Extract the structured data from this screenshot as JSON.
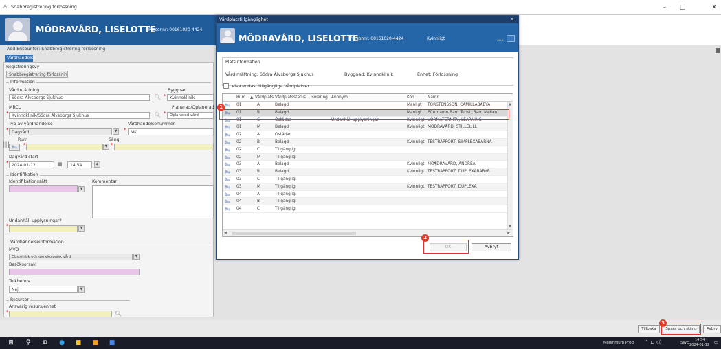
{
  "window": {
    "title": "Snabbregistrering förlossning",
    "minimize": "–",
    "maximize": "□",
    "close": "✕"
  },
  "patient": {
    "name": "MÖDRAVÅRD, LISELOTTE",
    "personnr_label": "Personnr:",
    "personnr": "00161020-4424",
    "gender": "Kvinnligt"
  },
  "encounter": {
    "title": "Add Encounter: Snabbregistrering förlossning",
    "tab": "Vårdhändelse"
  },
  "form": {
    "registreringsvy_label": "Registreringsvy",
    "registreringsvy_value": "Snabbregistrering förlossning",
    "information_label": "Information",
    "vardinrattning_label": "Vårdinrättning",
    "vardinrattning_value": "Södra Älvsborgs Sjukhus",
    "byggnad_label": "Byggnad",
    "byggnad_value": "Kvinnoklinik",
    "mrcu_label": "MRCU",
    "mrcu_value": "Kvinnoklinik/Södra Älvsborgs Sjukhus",
    "planerad_label": "Planerad/Oplanerad",
    "planerad_value": "Oplanerad vård",
    "typ_label": "Typ av vårdhändelse",
    "typ_value": "Dagvård",
    "vhnr_label": "Vårdhändelsenummer",
    "vhnr_value": "MK",
    "rum_label": "Rum",
    "sang_label": "Säng",
    "dagvard_start_label": "Dagvård start",
    "date_value": "2024-01-12",
    "time_value": "14:54",
    "identifikation_label": "Identifikation",
    "identifikationssatt_label": "Identifikationssätt",
    "kommentar_label": "Kommentar",
    "undanhall_label": "Undanhåll upplysningar?",
    "vhinfo_label": "Vårdhändelseinformation",
    "mvo_label": "MVO",
    "mvo_value": "Obstetrisk och gynekologisk vård",
    "besoksorsak_label": "Besöksorsak",
    "tolkbehov_label": "Tolkbehov",
    "tolkbehov_value": "Nej",
    "resurser_label": "Resurser",
    "ansvarig_label": "Ansvarig resurs/enhet"
  },
  "modal": {
    "title": "Vårdplatstillgänglighet",
    "close": "✕",
    "more": "...",
    "platsinfo_label": "Platsinformation",
    "vardinrattning": "Vårdinrättning:  Södra Älvsborgs Sjukhus",
    "byggnad": "Byggnad:  Kvinnoklinik",
    "enhet": "Enhet:  Förlossning",
    "checkbox_label": "Visa endast tillgängliga vårdplatser",
    "columns": [
      "Rum",
      "Vårdplats",
      "Vårdplatsstatus",
      "Isolering",
      "Anonym",
      "Kön",
      "Namn"
    ],
    "rows": [
      {
        "rum": "01",
        "plats": "A",
        "status": "Belagd",
        "anonym": "",
        "kon": "Manligt",
        "namn": "TORSTENSSON, CAMILLABABYA"
      },
      {
        "rum": "01",
        "plats": "B",
        "status": "Belagd",
        "anonym": "",
        "kon": "Manligt",
        "namn": "Efternamn Barn Turist, Barn Mellan"
      },
      {
        "rum": "01",
        "plats": "C",
        "status": "Ostädad",
        "anonym": "Undanhåll upplysningar",
        "kon": "Kvinnligt",
        "namn": "VÖRMATERNITY, LEARNING"
      },
      {
        "rum": "01",
        "plats": "M",
        "status": "Belagd",
        "anonym": "",
        "kon": "Kvinnligt",
        "namn": "MÖDRAVÅRD, STILLELILL"
      },
      {
        "rum": "02",
        "plats": "A",
        "status": "Ostädad",
        "anonym": "",
        "kon": "",
        "namn": ""
      },
      {
        "rum": "02",
        "plats": "B",
        "status": "Belagd",
        "anonym": "",
        "kon": "Kvinnligt",
        "namn": "TESTRAPPORT, SIMPLEXABARNA"
      },
      {
        "rum": "02",
        "plats": "C",
        "status": "Tillgänglig",
        "anonym": "",
        "kon": "",
        "namn": ""
      },
      {
        "rum": "02",
        "plats": "M",
        "status": "Tillgänglig",
        "anonym": "",
        "kon": "",
        "namn": ""
      },
      {
        "rum": "03",
        "plats": "A",
        "status": "Belagd",
        "anonym": "",
        "kon": "Kvinnligt",
        "namn": "MÖ¶DRAVÅRD, ANDREA"
      },
      {
        "rum": "03",
        "plats": "B",
        "status": "Belagd",
        "anonym": "",
        "kon": "Kvinnligt",
        "namn": "TESTRAPPORT, DUPLEXABABYB"
      },
      {
        "rum": "03",
        "plats": "C",
        "status": "Tillgänglig",
        "anonym": "",
        "kon": "",
        "namn": ""
      },
      {
        "rum": "03",
        "plats": "M",
        "status": "Tillgänglig",
        "anonym": "",
        "kon": "Kvinnligt",
        "namn": "TESTRAPPORT, DUPLEXA"
      },
      {
        "rum": "04",
        "plats": "A",
        "status": "Tillgänglig",
        "anonym": "",
        "kon": "",
        "namn": ""
      },
      {
        "rum": "04",
        "plats": "B",
        "status": "Tillgänglig",
        "anonym": "",
        "kon": "",
        "namn": ""
      },
      {
        "rum": "04",
        "plats": "C",
        "status": "Tillgänglig",
        "anonym": "",
        "kon": "",
        "namn": ""
      }
    ],
    "ok_label": "OK",
    "cancel_label": "Avbryt"
  },
  "bottom": {
    "tillbaka": "Tillbaka",
    "spara": "Spara och stäng",
    "avbryt": "Avbry"
  },
  "callouts": {
    "one": "1",
    "two": "2",
    "three": "3"
  },
  "taskbar": {
    "system": "Millennium Prod",
    "lang": "SWE",
    "time": "14:54",
    "date": "2024-01-12"
  },
  "colors": {
    "header_blue": "#1f5c99",
    "modal_title": "#1d3d6b",
    "callout_red": "#e03a2a",
    "required_pink": "#e9c6e9"
  }
}
